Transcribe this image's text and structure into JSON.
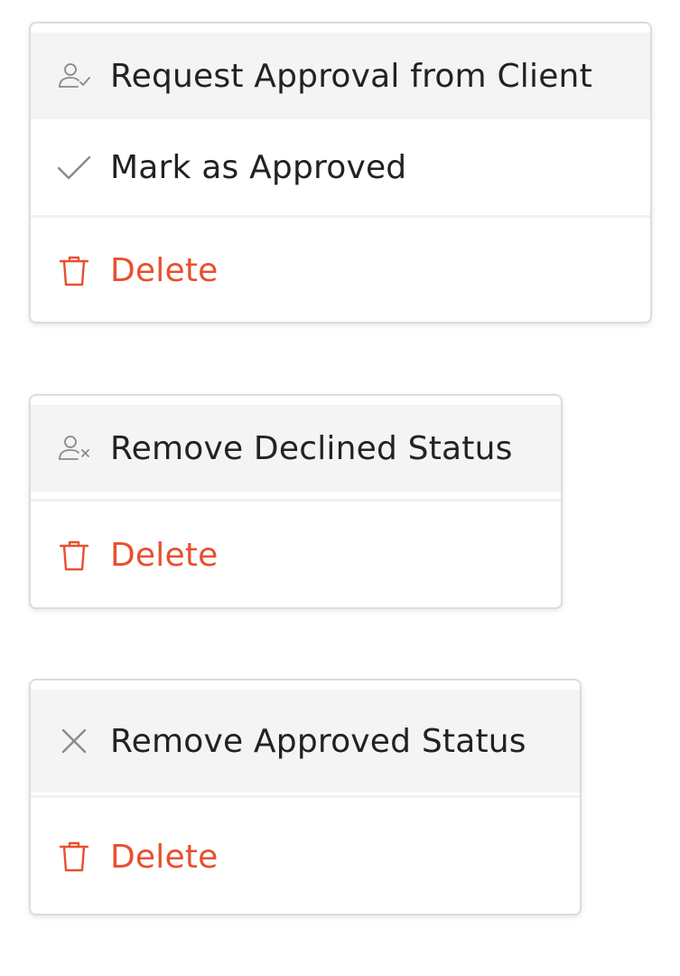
{
  "colors": {
    "highlight_bg": "#f4f4f4",
    "text": "#222222",
    "icon": "#8a8a8a",
    "danger": "#e8502f",
    "border": "#dcdcdc"
  },
  "menus": [
    {
      "items": [
        {
          "label": "Request Approval from Client",
          "icon": "user-check-icon"
        },
        {
          "label": "Mark as Approved",
          "icon": "checkmark-icon"
        },
        {
          "label": "Delete",
          "icon": "trash-icon"
        }
      ]
    },
    {
      "items": [
        {
          "label": "Remove Declined Status",
          "icon": "user-x-icon"
        },
        {
          "label": "Delete",
          "icon": "trash-icon"
        }
      ]
    },
    {
      "items": [
        {
          "label": "Remove Approved Status",
          "icon": "close-icon"
        },
        {
          "label": "Delete",
          "icon": "trash-icon"
        }
      ]
    }
  ]
}
